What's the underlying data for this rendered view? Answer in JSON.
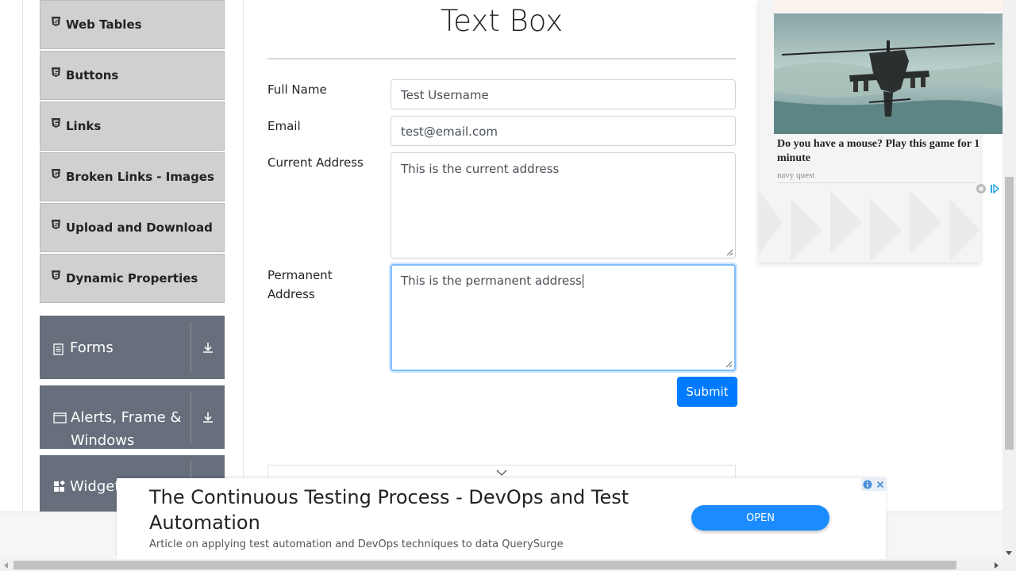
{
  "sidebar": {
    "elements_items": [
      {
        "label": "Web Tables"
      },
      {
        "label": "Buttons"
      },
      {
        "label": "Links"
      },
      {
        "label": "Broken Links - Images"
      },
      {
        "label": "Upload and Download"
      },
      {
        "label": "Dynamic Properties"
      }
    ],
    "groups": [
      {
        "label": "Forms",
        "icon": "form-icon"
      },
      {
        "label": "Alerts, Frame & Windows",
        "icon": "window-icon"
      },
      {
        "label": "Widgets",
        "icon": "widgets-icon"
      }
    ]
  },
  "main": {
    "title": "Text Box",
    "fields": {
      "full_name": {
        "label": "Full Name",
        "value": "Test Username"
      },
      "email": {
        "label": "Email",
        "value": "test@email.com"
      },
      "current_address": {
        "label": "Current Address",
        "value": "This is the current address"
      },
      "permanent_address": {
        "label_line1": "Permanent",
        "label_line2": "Address",
        "value": "This is the permanent address"
      }
    },
    "submit_label": "Submit"
  },
  "side_ad": {
    "headline": "Do you have a mouse? Play this game for 1 minute",
    "source": "navy quest"
  },
  "banner_ad": {
    "title": "The Continuous Testing Process - DevOps and Test Automation",
    "description": "Article on applying test automation and DevOps techniques to data QuerySurge",
    "open_label": "OPEN"
  },
  "colors": {
    "primary": "#007bff",
    "sidebar_item_bg": "#d0d0d0",
    "group_bg": "#666f7b",
    "focus_ring": "#80bdff"
  }
}
